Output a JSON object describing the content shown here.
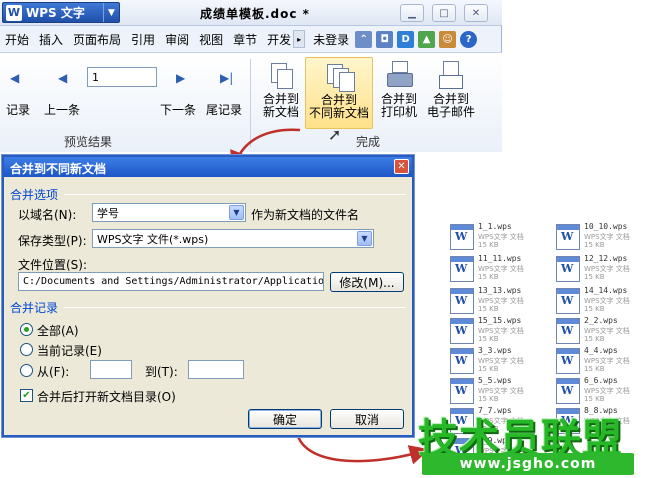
{
  "window": {
    "app_name": "WPS 文字",
    "app_logo": "W",
    "doc_title": "成绩单模板.doc *"
  },
  "menu": {
    "items": [
      "开始",
      "插入",
      "页面布局",
      "引用",
      "审阅",
      "视图",
      "章节",
      "开发"
    ],
    "login": "未登录",
    "more_glyph": "▸",
    "help_glyph": "?"
  },
  "ribbon": {
    "last_record": "记录",
    "prev_record": "上一条",
    "record_value": "1",
    "next_record": "下一条",
    "tail_record": "尾记录",
    "preview_group": "预览结果",
    "merge_new_doc": [
      "合并到",
      "新文档"
    ],
    "merge_separate_doc": [
      "合并到",
      "不同新文档"
    ],
    "merge_printer": [
      "合并到",
      "打印机"
    ],
    "merge_email": [
      "合并到",
      "电子邮件"
    ],
    "finish_group": "完成"
  },
  "dialog": {
    "title": "合并到不同新文档",
    "close": "✕",
    "section_options": "合并选项",
    "field_name_label": "以域名(N):",
    "field_name_value": "学号",
    "field_name_suffix": "作为新文档的文件名",
    "save_type_label": "保存类型(P):",
    "save_type_value": "WPS文字 文件(*.wps)",
    "location_label": "文件位置(S):",
    "location_value": "C:/Documents and Settings/Administrator/Application",
    "modify_button": "修改(M)...",
    "section_records": "合并记录",
    "radio_all": "全部(A)",
    "radio_current": "当前记录(E)",
    "radio_from": "从(F):",
    "to_label": "到(T):",
    "open_after_label": "合并后打开新文档目录(O)",
    "ok_button": "确定",
    "cancel_button": "取消"
  },
  "files": {
    "type_label": "WPS文字 文档",
    "size_label": "15 KB",
    "left": [
      "1_1.wps",
      "11_11.wps",
      "13_13.wps",
      "15_15.wps",
      "3_3.wps",
      "5_5.wps",
      "7_7.wps",
      "9_9.wps"
    ],
    "right": [
      "10_10.wps",
      "12_12.wps",
      "14_14.wps",
      "2_2.wps",
      "4_4.wps",
      "6_6.wps",
      "8_8.wps"
    ]
  },
  "watermark": {
    "text": "技术员联盟",
    "url": "www.jsgho.com"
  },
  "colors": {
    "dialog_title": "#1d56c6",
    "arrow": "#c0302a",
    "watermark": "#27b827"
  }
}
